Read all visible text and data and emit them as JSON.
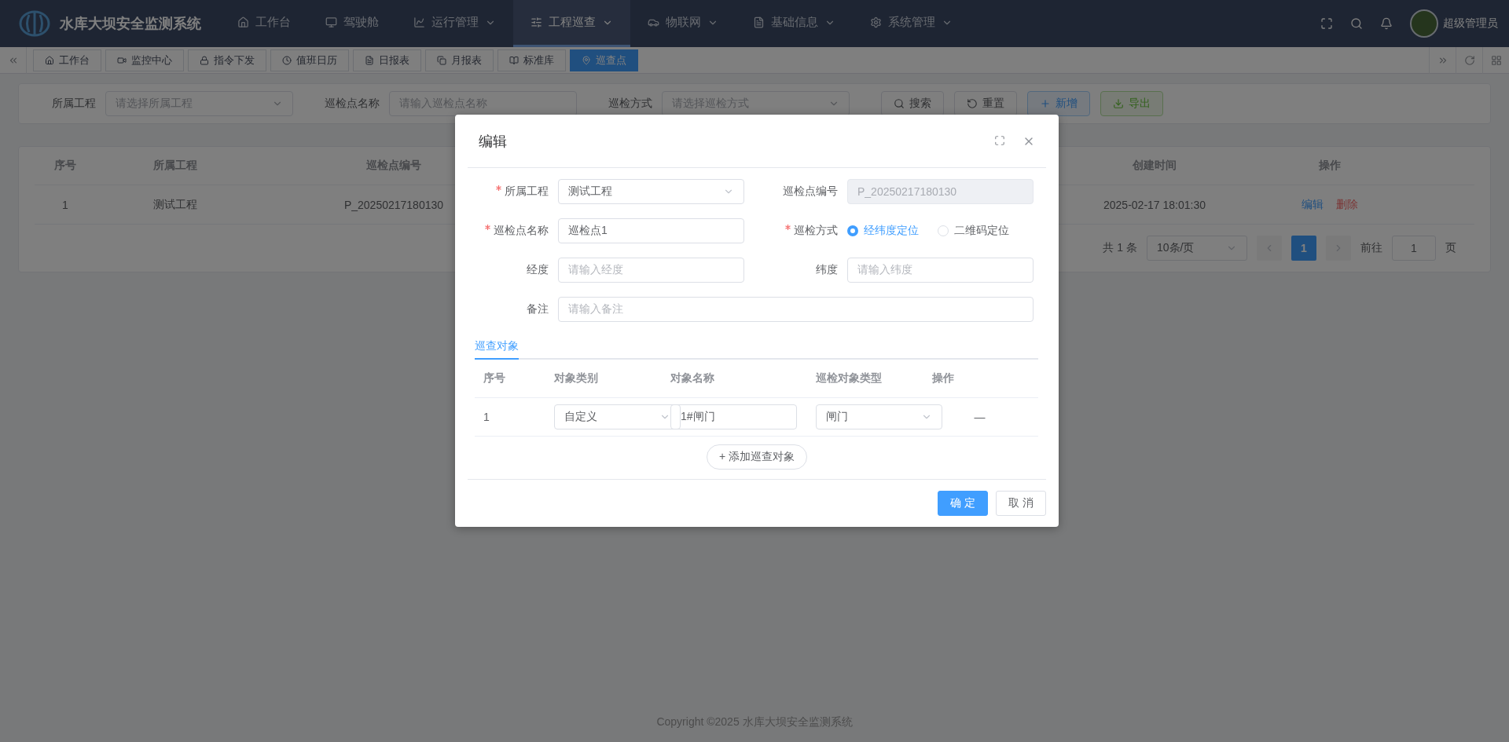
{
  "header": {
    "title": "水库大坝安全监测系统",
    "user": "超级管理员",
    "nav": [
      {
        "label": "工作台",
        "dropdown": false,
        "selected": false
      },
      {
        "label": "驾驶舱",
        "dropdown": false,
        "selected": false
      },
      {
        "label": "运行管理",
        "dropdown": true,
        "selected": false
      },
      {
        "label": "工程巡查",
        "dropdown": true,
        "selected": true
      },
      {
        "label": "物联网",
        "dropdown": true,
        "selected": false
      },
      {
        "label": "基础信息",
        "dropdown": true,
        "selected": false
      },
      {
        "label": "系统管理",
        "dropdown": true,
        "selected": false
      }
    ]
  },
  "tabs": [
    {
      "label": "工作台",
      "selected": false
    },
    {
      "label": "监控中心",
      "selected": false
    },
    {
      "label": "指令下发",
      "selected": false
    },
    {
      "label": "值班日历",
      "selected": false
    },
    {
      "label": "日报表",
      "selected": false
    },
    {
      "label": "月报表",
      "selected": false
    },
    {
      "label": "标准库",
      "selected": false
    },
    {
      "label": "巡查点",
      "selected": true
    }
  ],
  "filters": [
    {
      "label": "所属工程",
      "placeholder": "请选择所属工程",
      "kind": "select"
    },
    {
      "label": "巡检点名称",
      "placeholder": "请输入巡检点名称",
      "kind": "input"
    },
    {
      "label": "巡检方式",
      "placeholder": "请选择巡检方式",
      "kind": "select"
    }
  ],
  "filter_buttons": [
    {
      "label": "搜索",
      "kind": "search"
    },
    {
      "label": "重置",
      "kind": "reset"
    },
    {
      "label": "新增",
      "kind": "add"
    },
    {
      "label": "导出",
      "kind": "export"
    }
  ],
  "table": {
    "columns": [
      "序号",
      "所属工程",
      "巡检点编号",
      "创建时间",
      "操作"
    ],
    "rows": [
      {
        "cells": [
          "1",
          "测试工程",
          "P_20250217180130",
          "2025-02-17 18:01:30"
        ],
        "actions": [
          {
            "label": "编辑",
            "kind": "edit"
          },
          {
            "label": "删除",
            "kind": "delete"
          }
        ]
      }
    ]
  },
  "pagination": {
    "total": "共 1 条",
    "page_size": "10条/页",
    "pages": [
      {
        "label": "1",
        "selected": true
      }
    ],
    "goto_label": "前往",
    "goto_value": "1",
    "goto_suffix": "页"
  },
  "copyright": "Copyright ©2025 水库大坝安全监测系统",
  "dialog": {
    "title": "编辑",
    "fields": [
      {
        "label": "所属工程",
        "required": true,
        "kind": "select",
        "value": "测试工程",
        "disabled": false
      },
      {
        "label": "巡检点编号",
        "required": false,
        "kind": "input",
        "value": "P_20250217180130",
        "disabled": true
      },
      {
        "label": "巡检点名称",
        "required": true,
        "kind": "input",
        "value": "巡检点1",
        "disabled": false
      },
      {
        "label": "巡检方式",
        "required": true,
        "kind": "radio",
        "options": [
          {
            "label": "经纬度定位",
            "selected": true
          },
          {
            "label": "二维码定位",
            "selected": false
          }
        ]
      },
      {
        "label": "经度",
        "required": false,
        "kind": "input",
        "placeholder": "请输入经度",
        "disabled": false
      },
      {
        "label": "纬度",
        "required": false,
        "kind": "input",
        "placeholder": "请输入纬度",
        "disabled": false
      }
    ],
    "remark": {
      "label": "备注",
      "placeholder": "请输入备注"
    },
    "subtabs": [
      {
        "label": "巡查对象",
        "selected": true
      }
    ],
    "objects": {
      "columns": [
        "序号",
        "对象类别",
        "对象名称",
        "巡检对象类型",
        "操作"
      ],
      "rows": [
        {
          "index": "1",
          "category": "自定义",
          "name": "1#闸门",
          "type": "闸门",
          "action": "—"
        }
      ]
    },
    "add_button": "+ 添加巡查对象",
    "buttons": [
      {
        "label": "确 定",
        "kind": "primary"
      },
      {
        "label": "取 消",
        "kind": "default"
      }
    ]
  }
}
